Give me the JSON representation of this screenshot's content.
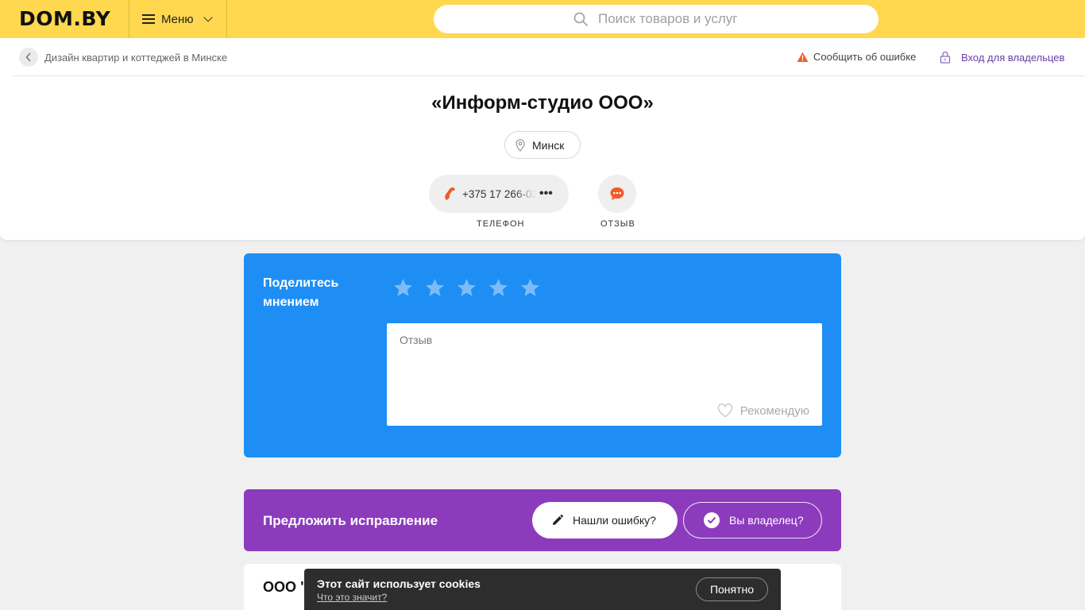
{
  "header": {
    "logo": "DOM.BY",
    "menu_label": "Меню",
    "search_placeholder": "Поиск товаров и услуг"
  },
  "breadcrumb": {
    "back_label": "Дизайн квартир и коттеджей в Минске"
  },
  "top_actions": {
    "report_error": "Сообщить об ошибке",
    "owner_login": "Вход для владельцев"
  },
  "company": {
    "title": "«Информ-студио ООО»",
    "city": "Минск",
    "phone": "+375 17 266-02",
    "phone_caption": "ТЕЛЕФОН",
    "review_caption": "ОТЗЫВ"
  },
  "rating": {
    "heading": "Поделитесь мнением",
    "stars_total": 5,
    "review_placeholder": "Отзыв",
    "recommend_label": "Рекомендую"
  },
  "correction": {
    "heading": "Предложить исправление",
    "found_error": "Нашли ошибку?",
    "are_owner": "Вы владелец?"
  },
  "details": {
    "name_partial": "ООО \""
  },
  "cookies": {
    "title": "Этот сайт использует cookies",
    "link": "Что это значит?",
    "accept": "Понятно"
  },
  "colors": {
    "topbar": "#ffd84f",
    "rate_block": "#1e8ef5",
    "fix_block": "#8c3bbd",
    "accent_orange": "#f05a28",
    "owner_link": "#6a3ea1"
  }
}
